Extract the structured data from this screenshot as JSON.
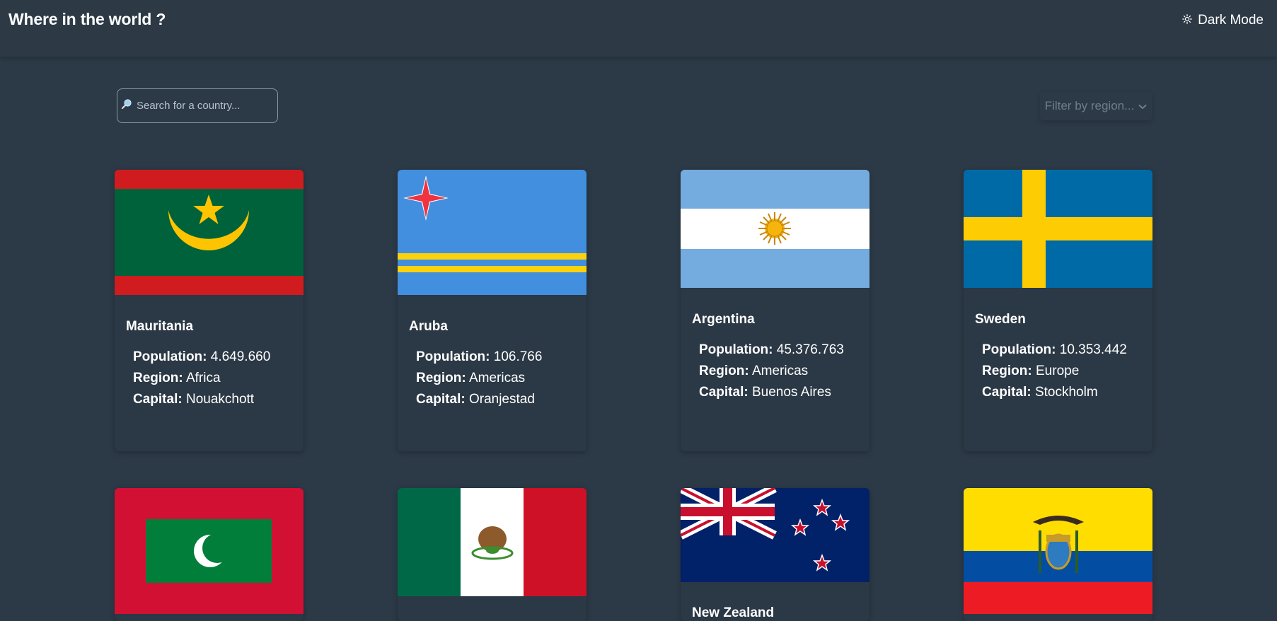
{
  "header": {
    "title": "Where in the world ?",
    "mode_label": "Dark Mode"
  },
  "search": {
    "placeholder": "Search for a country..."
  },
  "filter": {
    "label": "Filter by region..."
  },
  "labels": {
    "population": "Population:",
    "region": "Region:",
    "capital": "Capital:"
  },
  "countries": [
    {
      "name": "Mauritania",
      "population": "4.649.660",
      "region": "Africa",
      "capital": "Nouakchott"
    },
    {
      "name": "Aruba",
      "population": "106.766",
      "region": "Americas",
      "capital": "Oranjestad"
    },
    {
      "name": "Argentina",
      "population": "45.376.763",
      "region": "Americas",
      "capital": "Buenos Aires"
    },
    {
      "name": "Sweden",
      "population": "10.353.442",
      "region": "Europe",
      "capital": "Stockholm"
    },
    {
      "name": "",
      "population": "",
      "region": "",
      "capital": ""
    },
    {
      "name": "",
      "population": "",
      "region": "",
      "capital": ""
    },
    {
      "name": "New Zealand",
      "population": "",
      "region": "",
      "capital": ""
    },
    {
      "name": "",
      "population": "",
      "region": "",
      "capital": ""
    }
  ]
}
